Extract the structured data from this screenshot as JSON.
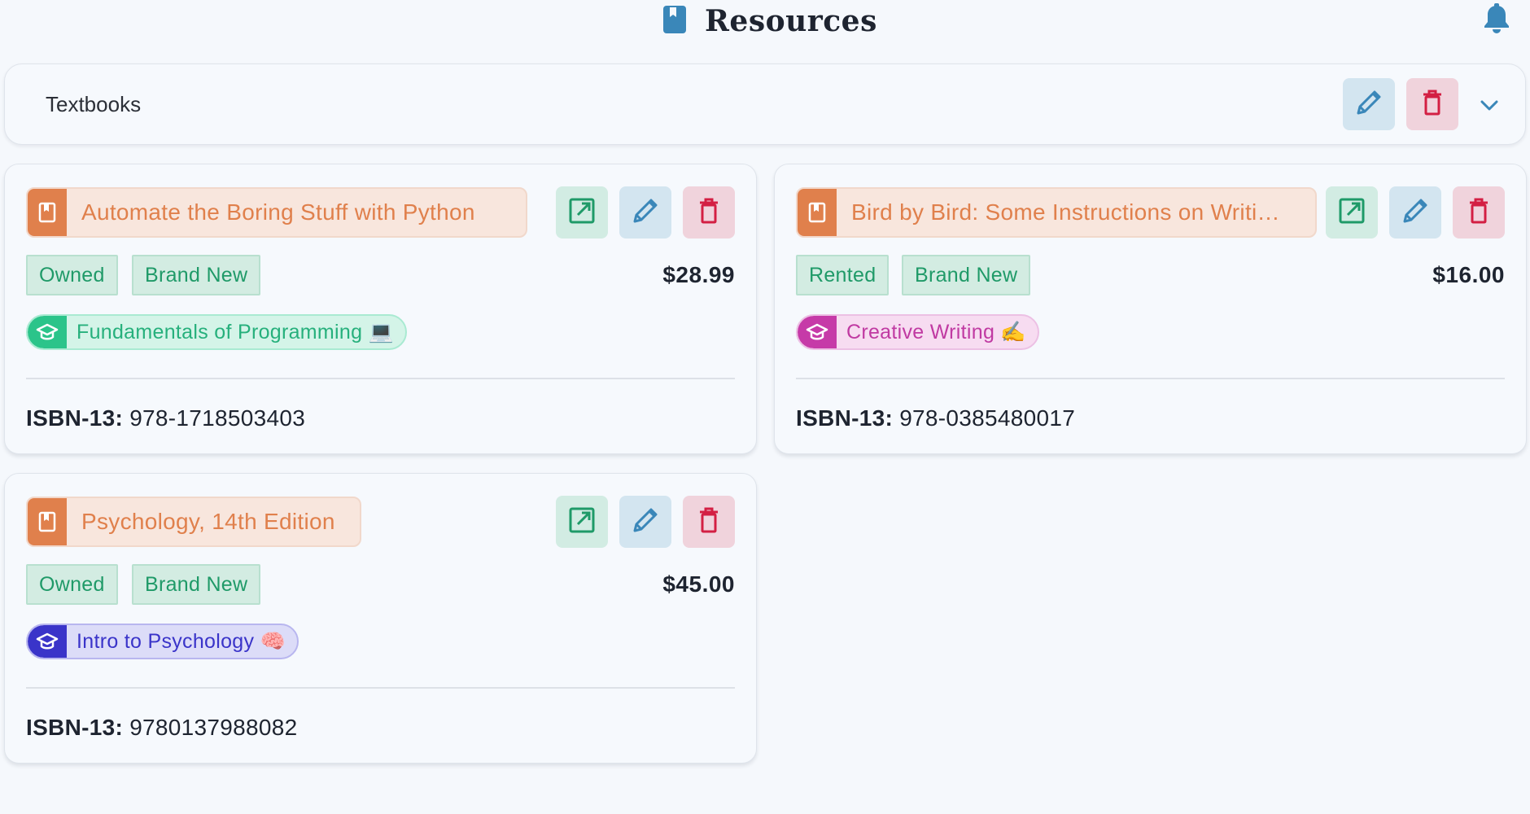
{
  "header": {
    "title": "Resources",
    "logo_icon": "book-bookmark-icon",
    "bell_icon": "bell-icon"
  },
  "category": {
    "name": "Textbooks",
    "edit_icon": "pencil-icon",
    "delete_icon": "trash-icon",
    "toggle_icon": "chevron-down-icon"
  },
  "colors": {
    "accent_blue": "#3a87b9",
    "green": "#1f9a68",
    "red": "#d31f43",
    "orange": "#e0804c"
  },
  "books": [
    {
      "title": "Automate the Boring Stuff with Python",
      "tags": [
        "Owned",
        "Brand New"
      ],
      "price": "$28.99",
      "course": "Fundamentals of Programming 💻",
      "course_color": "#2bc48a",
      "isbn_label": "ISBN-13:",
      "isbn": "978-1718503403"
    },
    {
      "title": "Bird by Bird: Some Instructions on Writi…",
      "tags": [
        "Rented",
        "Brand New"
      ],
      "price": "$16.00",
      "course": "Creative Writing ✍️",
      "course_color": "#c63aa8",
      "isbn_label": "ISBN-13:",
      "isbn": "978-0385480017"
    },
    {
      "title": "Psychology, 14th Edition",
      "tags": [
        "Owned",
        "Brand New"
      ],
      "price": "$45.00",
      "course": "Intro to Psychology 🧠",
      "course_color": "#3a34c9",
      "isbn_label": "ISBN-13:",
      "isbn": "9780137988082"
    }
  ]
}
